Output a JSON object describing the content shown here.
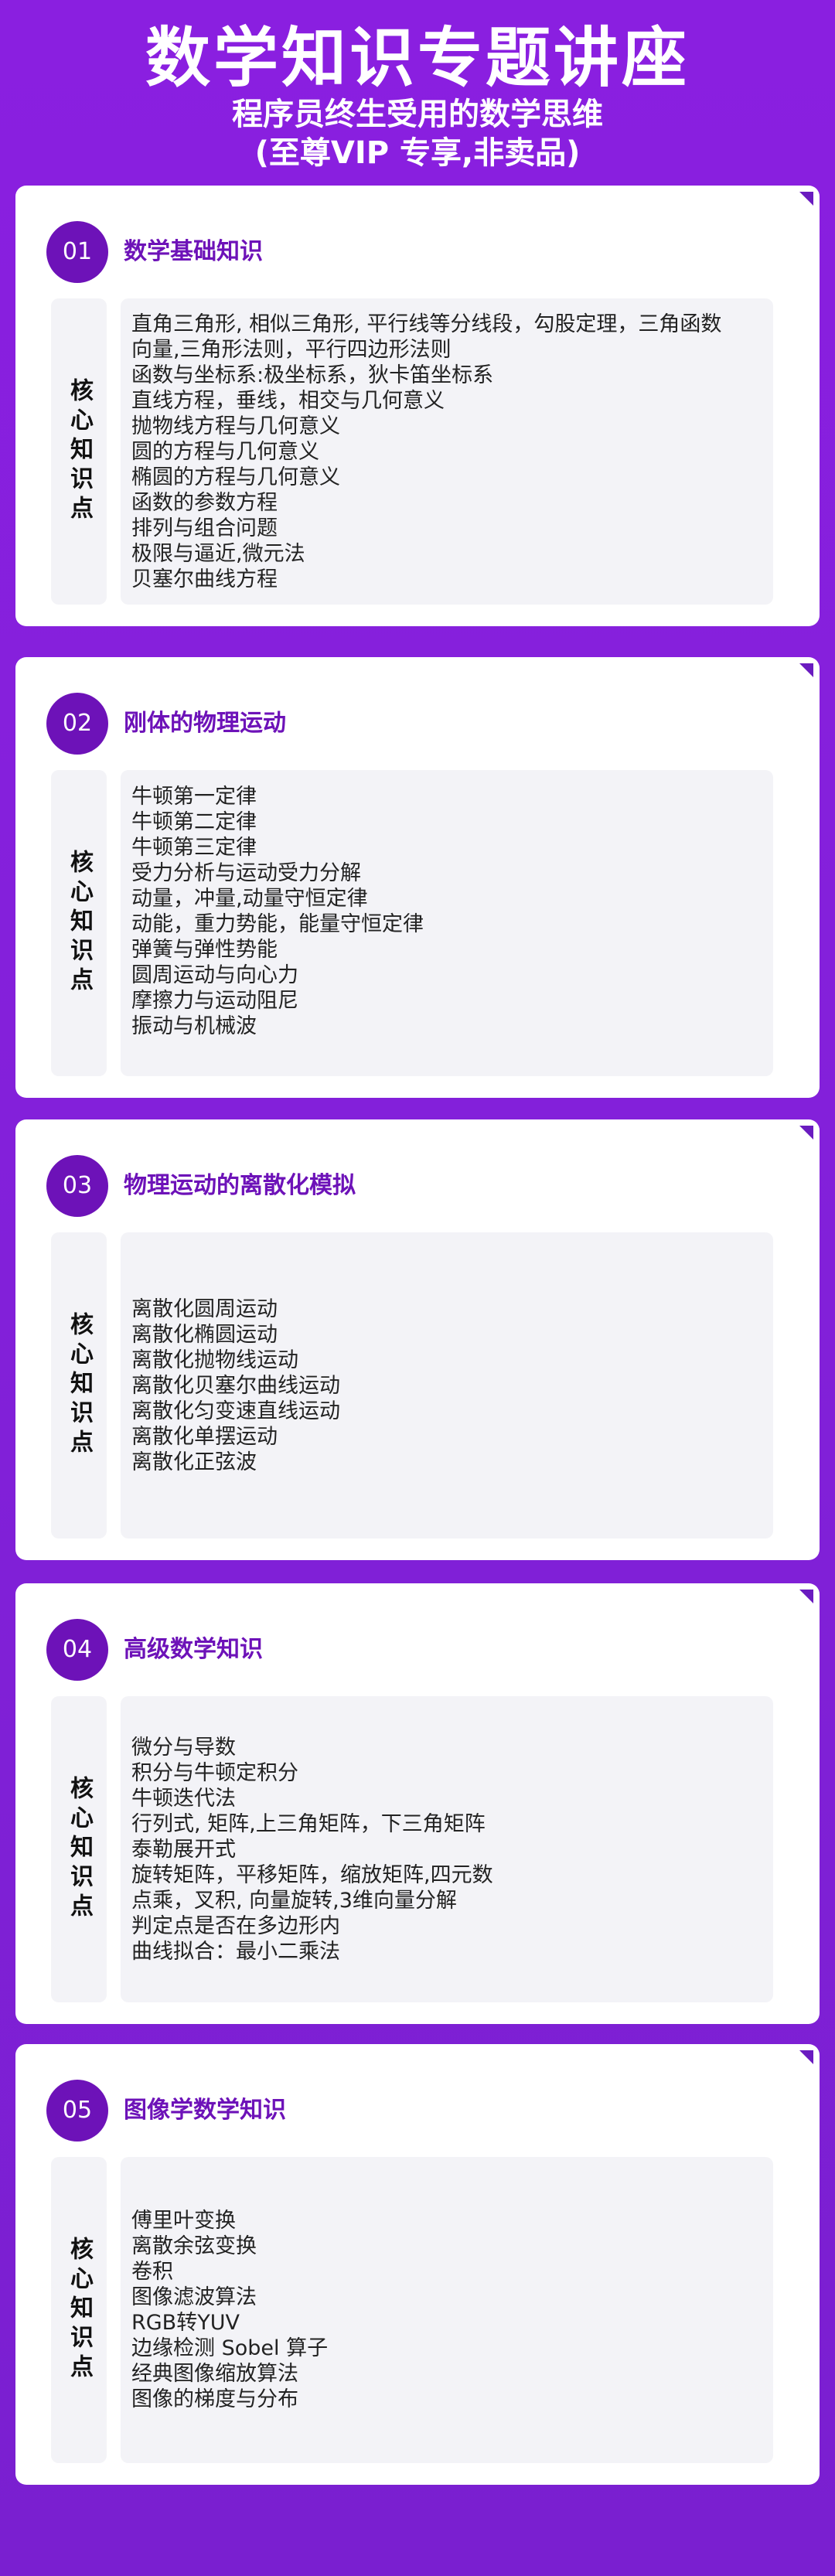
{
  "header": {
    "title": "数学知识专题讲座",
    "subtitle_line1": "程序员终生受用的数学思维",
    "subtitle_line2": "(至尊VIP 专享,非卖品)"
  },
  "side_label": "核心知识点",
  "colors": {
    "background": "#8220d9",
    "accent": "#6d12b8",
    "card": "#ffffff",
    "panel": "#f3f3f7"
  },
  "sections": [
    {
      "number": "01",
      "title": "数学基础知识",
      "items": [
        "直角三角形, 相似三角形, 平行线等分线段，勾股定理，三角函数",
        "向量,三角形法则，平行四边形法则",
        "函数与坐标系:极坐标系，狄卡笛坐标系",
        "直线方程，垂线，相交与几何意义",
        "抛物线方程与几何意义",
        "圆的方程与几何意义",
        "椭圆的方程与几何意义",
        "函数的参数方程",
        "排列与组合问题",
        "极限与逼近,微元法",
        "贝塞尔曲线方程"
      ]
    },
    {
      "number": "02",
      "title": "刚体的物理运动",
      "items": [
        "牛顿第一定律",
        "牛顿第二定律",
        "牛顿第三定律",
        "受力分析与运动受力分解",
        "动量，冲量,动量守恒定律",
        "动能，重力势能，能量守恒定律",
        "弹簧与弹性势能",
        "圆周运动与向心力",
        "摩擦力与运动阻尼",
        "振动与机械波"
      ]
    },
    {
      "number": "03",
      "title": "物理运动的离散化模拟",
      "items": [
        "离散化圆周运动",
        "离散化椭圆运动",
        "离散化抛物线运动",
        "离散化贝塞尔曲线运动",
        "离散化匀变速直线运动",
        "离散化单摆运动",
        "离散化正弦波"
      ]
    },
    {
      "number": "04",
      "title": "高级数学知识",
      "items": [
        "微分与导数",
        "积分与牛顿定积分",
        "牛顿迭代法",
        "行列式, 矩阵,上三角矩阵，下三角矩阵",
        "泰勒展开式",
        "旋转矩阵，平移矩阵，缩放矩阵,四元数",
        "点乘，叉积, 向量旋转,3维向量分解",
        "判定点是否在多边形内",
        "曲线拟合：最小二乘法"
      ]
    },
    {
      "number": "05",
      "title": "图像学数学知识",
      "items": [
        "傅里叶变换",
        "离散余弦变换",
        "卷积",
        "图像滤波算法",
        "RGB转YUV",
        "边缘检测 Sobel 算子",
        "经典图像缩放算法",
        "图像的梯度与分布"
      ]
    }
  ]
}
